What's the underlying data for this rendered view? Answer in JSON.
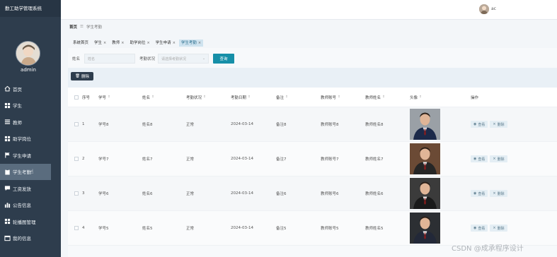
{
  "app": {
    "title": "勤工助学管理系统",
    "user": "admin",
    "top_user": "ac"
  },
  "sidebar": {
    "items": [
      {
        "label": "首页",
        "icon": "home-icon"
      },
      {
        "label": "学生",
        "icon": "grid-icon"
      },
      {
        "label": "教师",
        "icon": "list-icon"
      },
      {
        "label": "助学岗位",
        "icon": "grid-icon"
      },
      {
        "label": "学生申请",
        "icon": "flag-icon"
      },
      {
        "label": "学生考勤",
        "icon": "clipboard-icon",
        "active": true
      },
      {
        "label": "工资发放",
        "icon": "chat-icon"
      },
      {
        "label": "公告信息",
        "icon": "bar-chart-icon"
      },
      {
        "label": "轮播图管理",
        "icon": "grid-icon"
      },
      {
        "label": "我的信息",
        "icon": "window-icon"
      }
    ]
  },
  "breadcrumb": {
    "home": "首页",
    "separator": "☰",
    "current": "学生考勤"
  },
  "tabs": [
    {
      "label": "系统首页",
      "closable": false
    },
    {
      "label": "学生",
      "closable": true
    },
    {
      "label": "教师",
      "closable": true
    },
    {
      "label": "助学岗位",
      "closable": true
    },
    {
      "label": "学生申请",
      "closable": true
    },
    {
      "label": "学生考勤",
      "closable": true,
      "active": true
    }
  ],
  "search": {
    "name_label": "姓名",
    "name_placeholder": "姓名",
    "status_label": "考勤状况",
    "status_placeholder": "请选择考勤状况",
    "query_button": "查询"
  },
  "toolbar": {
    "delete_button": "删除"
  },
  "table": {
    "columns": [
      "序号",
      "学号",
      "姓名",
      "考勤状况",
      "考勤日期",
      "备注",
      "教师账号",
      "教师姓名",
      "头像",
      "操作"
    ],
    "rows": [
      {
        "idx": "1",
        "sid": "学号8",
        "sname": "姓名8",
        "status": "正常",
        "date": "2024-03-14",
        "note": "备注8",
        "tacc": "教师账号8",
        "tname": "教师姓名8"
      },
      {
        "idx": "2",
        "sid": "学号7",
        "sname": "姓名7",
        "status": "正常",
        "date": "2024-03-14",
        "note": "备注7",
        "tacc": "教师账号7",
        "tname": "教师姓名7"
      },
      {
        "idx": "3",
        "sid": "学号6",
        "sname": "姓名6",
        "status": "正常",
        "date": "2024-03-14",
        "note": "备注6",
        "tacc": "教师账号6",
        "tname": "教师姓名6"
      },
      {
        "idx": "4",
        "sid": "学号5",
        "sname": "姓名5",
        "status": "正常",
        "date": "2024-03-14",
        "note": "备注5",
        "tacc": "教师账号5",
        "tname": "教师姓名5"
      }
    ],
    "view_label": "查看",
    "delete_label": "删除"
  },
  "watermark": "CSDN @成承程序设计",
  "colors": {
    "sidebar": "#2e3d4d",
    "accent": "#168fa8",
    "active_tab": "#cfe3ef"
  }
}
